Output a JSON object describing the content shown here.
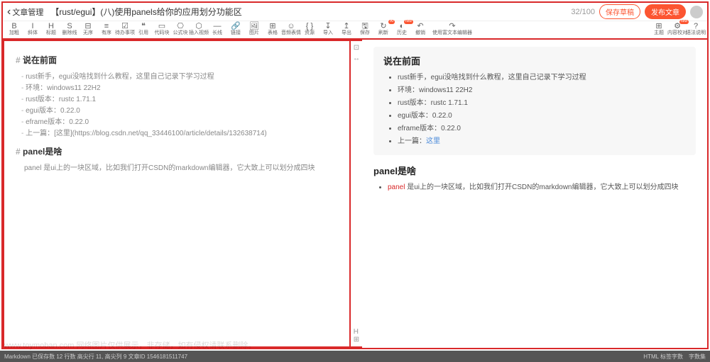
{
  "header": {
    "back_label": "文章管理",
    "title_value": "【rust/egui】(八)使用panels给你的应用划分功能区",
    "counter": "32/100",
    "save_draft_label": "保存草稿",
    "publish_label": "发布文章"
  },
  "toolbar": {
    "items": [
      {
        "icon": "B",
        "label": "加粗"
      },
      {
        "icon": "I",
        "label": "斜体"
      },
      {
        "icon": "H",
        "label": "标题"
      },
      {
        "icon": "S",
        "label": "删除线"
      },
      {
        "icon": "⊟",
        "label": "无序"
      },
      {
        "icon": "≡",
        "label": "有序"
      },
      {
        "icon": "☑",
        "label": "待办事项"
      },
      {
        "icon": "❝",
        "label": "引用"
      },
      {
        "icon": "▭",
        "label": "代码块"
      },
      {
        "icon": "⎔",
        "label": "公式块"
      },
      {
        "icon": "⬡",
        "label": "插入视频"
      },
      {
        "icon": "—",
        "label": "长线"
      },
      {
        "icon": "🔗",
        "label": "链接"
      },
      {
        "icon": "🖼",
        "label": "图片"
      },
      {
        "icon": "⊞",
        "label": "表格"
      },
      {
        "icon": "☺",
        "label": "音频表情"
      },
      {
        "icon": "{ }",
        "label": "资源"
      },
      {
        "icon": "↧",
        "label": "导入"
      },
      {
        "icon": "↥",
        "label": "导出"
      },
      {
        "icon": "🖫",
        "label": "保存"
      },
      {
        "icon": "↻",
        "label": "刷新",
        "badge": "AI"
      },
      {
        "icon": "◐",
        "label": "历史",
        "badge": "new"
      },
      {
        "icon": "↶",
        "label": "撤销"
      },
      {
        "icon": "↷",
        "label": "使用富文本编辑器",
        "wide": true
      }
    ],
    "right_items": [
      {
        "icon": "⊞",
        "label": "主题"
      },
      {
        "icon": "⚙",
        "label": "内容校对",
        "badge": "new"
      },
      {
        "icon": "?",
        "label": "语法说明"
      }
    ]
  },
  "editor": {
    "section1": {
      "heading": "说在前面",
      "lines": [
        "rust新手，egui没啥找到什么教程，这里自己记录下学习过程",
        "环境：windows11 22H2",
        "rust版本：rustc 1.71.1",
        "egui版本：0.22.0",
        "eframe版本：0.22.0",
        "上一篇：[这里](https://blog.csdn.net/qq_33446100/article/details/132638714)"
      ]
    },
    "section2": {
      "heading": "panel是啥",
      "line": "panel 是ui上的一块区域，比如我们打开CSDN的markdown编辑器，它大致上可以划分成四块"
    }
  },
  "preview": {
    "section1": {
      "heading": "说在前面",
      "items": [
        "rust新手，egui没啥找到什么教程，这里自己记录下学习过程",
        "环境：windows11 22H2",
        "rust版本：rustc 1.71.1",
        "egui版本：0.22.0",
        "eframe版本：0.22.0"
      ],
      "last_prefix": "上一篇：",
      "last_link": "这里"
    },
    "section2": {
      "heading": "panel是啥",
      "kw": "panel",
      "rest": " 是ui上的一块区域，比如我们打开CSDN的markdown编辑器，它大致上可以划分成四块"
    }
  },
  "gutter": {
    "top1": "⊡",
    "top2": "↔",
    "bot1": "H",
    "bot2": "⊞"
  },
  "status": {
    "left": "Markdown  已保存数 12 行数  高尖行 11, 高尖列 9  文章ID 1546181511747",
    "right1": "HTML 标签字数",
    "right2": "字数集"
  },
  "watermark": "www.toymoban.com 网络图片仅供展示，非存储，如有侵权请联系删除。"
}
